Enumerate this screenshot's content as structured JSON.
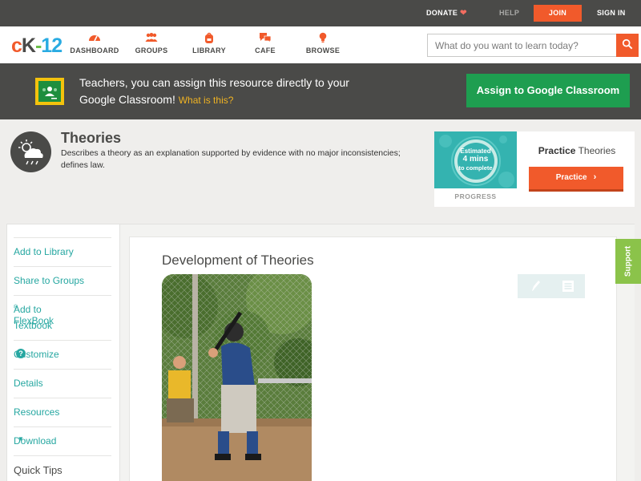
{
  "topbar": {
    "donate": "DONATE",
    "help": "HELP",
    "join": "JOIN",
    "sign_in": "SIGN IN"
  },
  "header": {
    "logo": {
      "c": "c",
      "k": "K",
      "dash": "-",
      "num": "12"
    },
    "nav": {
      "dashboard": "DASHBOARD",
      "groups": "GROUPS",
      "library": "LIBRARY",
      "cafe": "CAFE",
      "browse": "BROWSE"
    },
    "search_placeholder": "What do you want to learn today?"
  },
  "classroom_banner": {
    "message": "Teachers, you can assign this resource directly to your Google Classroom!",
    "what_link": "What is this?",
    "assign_button": "Assign to Google Classroom"
  },
  "concept": {
    "title": "Theories",
    "description": "Describes a theory as an explanation supported by evidence with no major inconsistencies; defines law."
  },
  "practice": {
    "estimate_line1": "Estimated",
    "estimate_minutes": "4 mins",
    "estimate_line3": "to complete",
    "progress_label": "PROGRESS",
    "heading_bold": "Practice",
    "heading_rest": "Theories",
    "button": "Practice"
  },
  "sidebar": {
    "add_library": "Add to Library",
    "share_groups": "Share to Groups",
    "add_flexbook_1": "Add to FlexBook",
    "add_flexbook_sup": "®",
    "add_flexbook_2": "Textbook",
    "customize": "Customize",
    "customize_help": "?",
    "details": "Details",
    "resources": "Resources",
    "download": "Download",
    "quick_tips": "Quick Tips"
  },
  "article": {
    "title": "Development of Theories"
  },
  "support_tab": "Support",
  "colors": {
    "brand_orange": "#f15a2b",
    "teal_link": "#26a7a1",
    "classroom_green": "#1e9e50",
    "support_green": "#8bc34a",
    "dark_bar": "#4a4a48"
  },
  "icons": {
    "dashboard": "speedometer-icon",
    "groups": "people-icon",
    "library": "backpack-icon",
    "cafe": "chat-bubbles-icon",
    "browse": "lightbulb-icon",
    "search": "search-icon",
    "concept": "cloud-sun-rain-icon",
    "edit": "pencil-icon",
    "notes": "notes-icon"
  }
}
